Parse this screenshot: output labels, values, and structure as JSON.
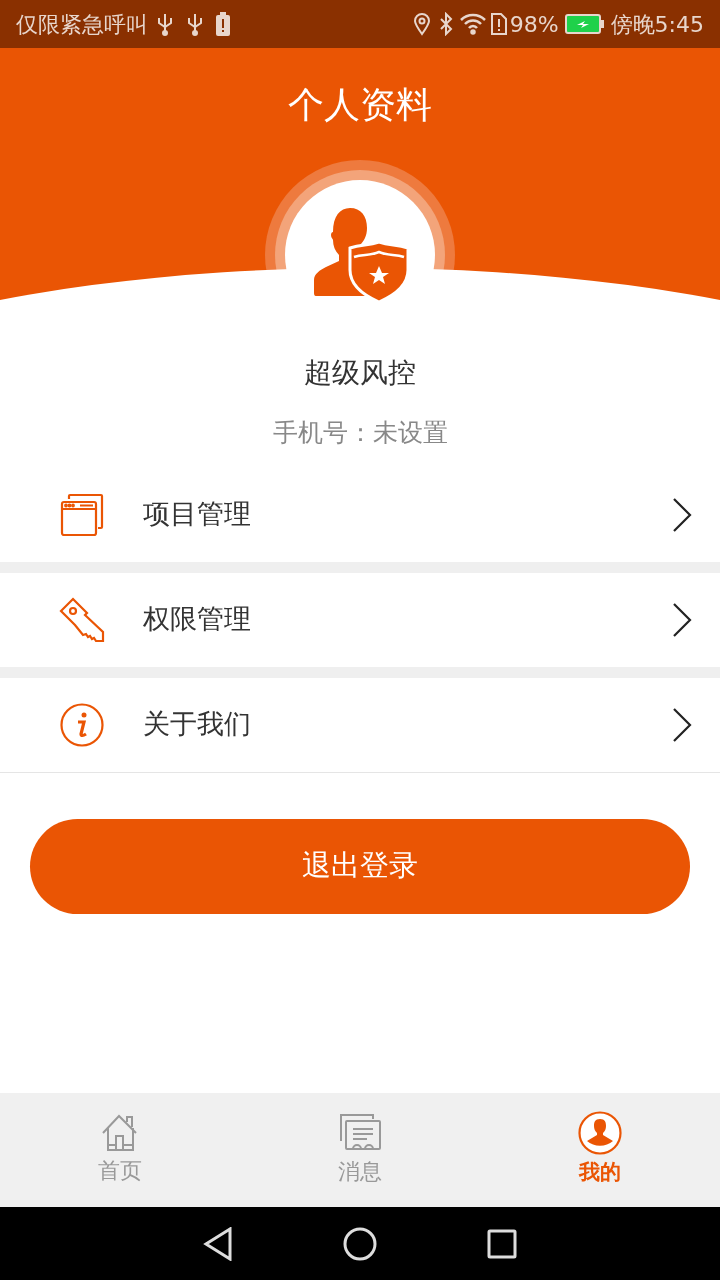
{
  "status_bar": {
    "carrier": "仅限紧急呼叫",
    "battery": "98%",
    "time": "傍晚5:45"
  },
  "title": "个人资料",
  "profile": {
    "name": "超级风控",
    "phone": "手机号：未设置"
  },
  "menu": [
    {
      "label": "项目管理"
    },
    {
      "label": "权限管理"
    },
    {
      "label": "关于我们"
    }
  ],
  "logout_button": "退出登录",
  "tabs": [
    {
      "label": "首页",
      "selected": false
    },
    {
      "label": "消息",
      "selected": false
    },
    {
      "label": "我的",
      "selected": true
    }
  ]
}
